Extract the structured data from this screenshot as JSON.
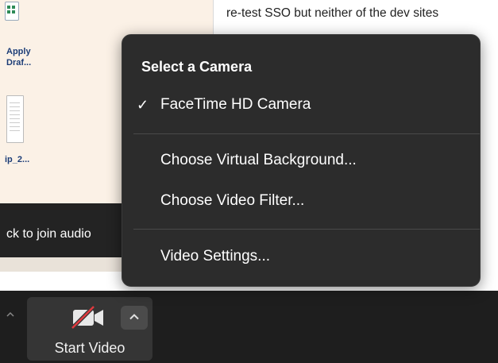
{
  "document": {
    "text": "re-test SSO but neither of the dev sites"
  },
  "desktop": {
    "icon_1_label": "Apply Draf...",
    "icon_2_label": "ip_2..."
  },
  "audio": {
    "text": "ck to join audio"
  },
  "camera_menu": {
    "heading": "Select a Camera",
    "check_mark": "✓",
    "items": [
      {
        "label": "FaceTime HD Camera",
        "selected": true
      },
      {
        "label": "Choose Virtual Background..."
      },
      {
        "label": "Choose Video Filter..."
      },
      {
        "label": "Video Settings..."
      }
    ]
  },
  "toolbar": {
    "video_label": "Start Video",
    "video_icon": "camera-off-icon",
    "options_icon": "chevron-up-icon"
  },
  "colors": {
    "menu_bg": "#2c2c2c",
    "toolbar_bg": "#1e1e1e",
    "video_button_bg": "#353535",
    "muted_slash": "#e0393e"
  }
}
